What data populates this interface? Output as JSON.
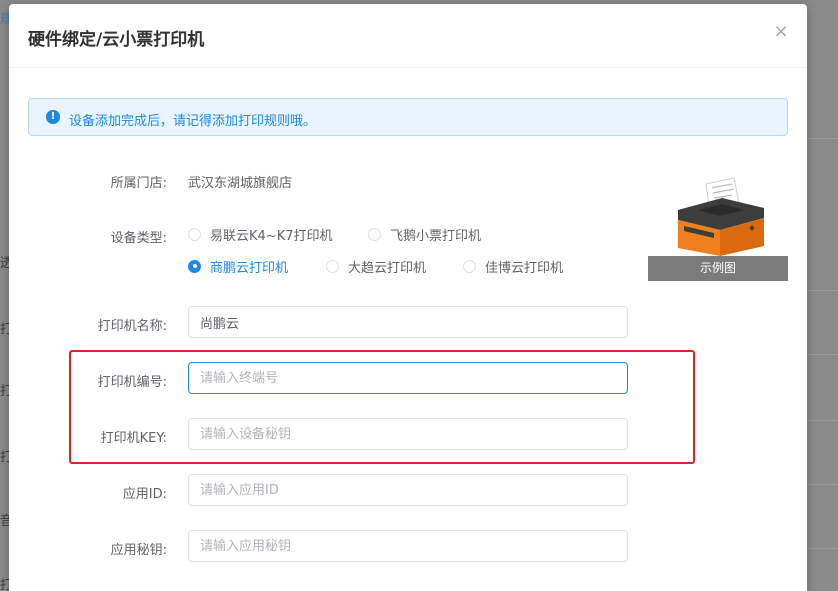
{
  "dialog": {
    "title": "硬件绑定/云小票打印机",
    "close_symbol": "×"
  },
  "alert": {
    "icon": "info-icon",
    "icon_glyph": "!",
    "text": "设备添加完成后，请记得添加打印规则哦。"
  },
  "form": {
    "store": {
      "label": "所属门店:",
      "value": "武汉东湖城旗舰店"
    },
    "device_type": {
      "label": "设备类型:",
      "options": [
        {
          "label": "易联云K4~K7打印机",
          "checked": false
        },
        {
          "label": "飞鹅小票打印机",
          "checked": false
        },
        {
          "label": "商鹏云打印机",
          "checked": true
        },
        {
          "label": "大趋云打印机",
          "checked": false
        },
        {
          "label": "佳博云打印机",
          "checked": false
        }
      ]
    },
    "printer_name": {
      "label": "打印机名称:",
      "value": "尚鹏云",
      "placeholder": ""
    },
    "printer_no": {
      "label": "打印机编号:",
      "value": "",
      "placeholder": "请输入终端号"
    },
    "printer_key": {
      "label": "打印机KEY:",
      "value": "",
      "placeholder": "请输入设备秘钥"
    },
    "app_id": {
      "label": "应用ID:",
      "value": "",
      "placeholder": "请输入应用ID"
    },
    "app_secret": {
      "label": "应用秘钥:",
      "value": "",
      "placeholder": "请输入应用秘钥"
    }
  },
  "example_image": {
    "caption": "示例图"
  },
  "colors": {
    "primary": "#1e88e5",
    "alert_bg": "#e8f4ff",
    "highlight": "#e3212d",
    "printer_body": "#f07f1e"
  }
}
